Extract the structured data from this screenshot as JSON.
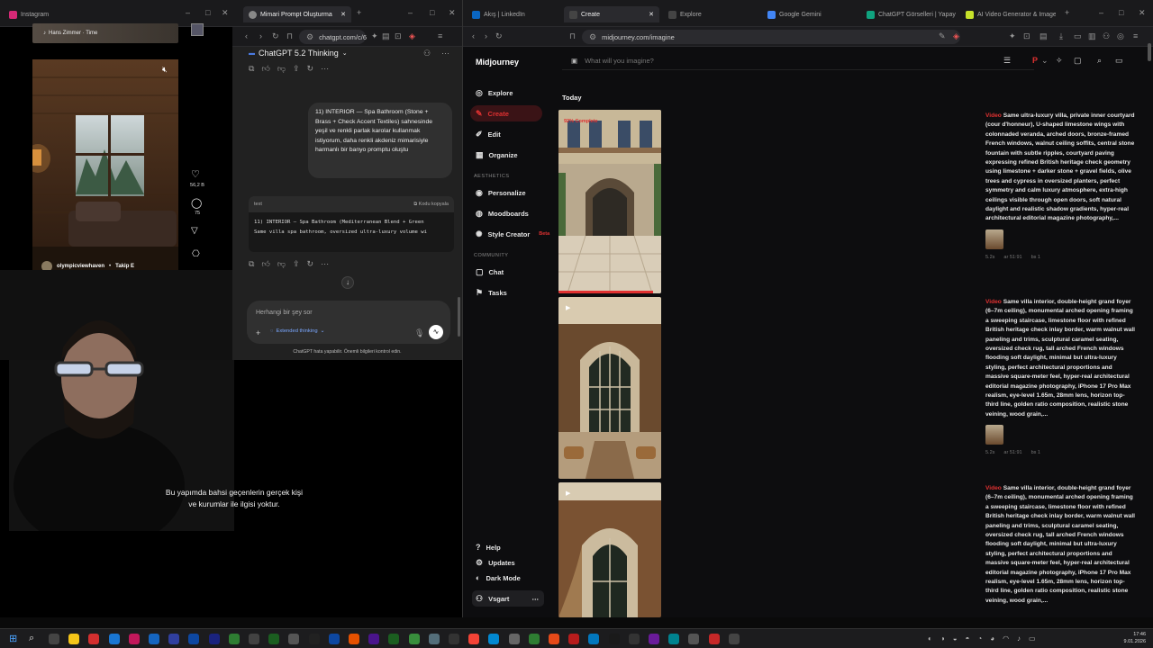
{
  "instagram": {
    "tab_title": "Instagram",
    "music": "Hans Zimmer · Time",
    "like_count": "56,2 B",
    "comment_count": "75",
    "username": "olympicviewhaven",
    "follow_label": "Takip E"
  },
  "subtitle": {
    "line1": "Bu yapımda bahsi geçenlerin gerçek kişi",
    "line2": "ve kurumlar ile ilgisi yoktur."
  },
  "chatgpt": {
    "tab_title": "Mimari Prompt Oluşturma",
    "url": "chatgpt.com/c/6",
    "model": "ChatGPT 5.2 Thinking",
    "user_message": "11) INTERIOR — Spa Bathroom (Stone + Brass + Check Accent Textiles) sahnesinde yeşil ve renkli parlak karolar kullanmak istiyorum, daha renkli akdeniz mimarisiyle harmanlı bir banyo promptu oluştu",
    "code_lang": "text",
    "copy_code_label": "Kodu kopyala",
    "code_line1": "11) INTERIOR — Spa Bathroom (Mediterranean Blend + Green",
    "code_line2": "Same villa spa bathroom, oversized ultra-luxury volume wi",
    "input_placeholder": "Herhangi bir şey sor",
    "extended_thinking": "Extended thinking",
    "footer": "ChatGPT hata yapabilir. Önemli bilgileri kontrol edin."
  },
  "browser2": {
    "tabs": [
      {
        "title": "Akış | LinkedIn",
        "color": "#0a66c2"
      },
      {
        "title": "Create",
        "color": "#444"
      },
      {
        "title": "Explore",
        "color": "#444"
      },
      {
        "title": "Google Gemini",
        "color": "#4285f4"
      },
      {
        "title": "ChatGPT Görselleri | Yapay Zekâ",
        "color": "#10a37f"
      },
      {
        "title": "AI Video Generator & Image Ge",
        "color": "#c6e12a"
      }
    ],
    "url": "midjourney.com/imagine"
  },
  "midjourney": {
    "brand": "Midjourney",
    "search_placeholder": "What will you imagine?",
    "nav": [
      "Explore",
      "Create",
      "Edit",
      "Organize"
    ],
    "aesthetics_heading": "AESTHETICS",
    "aesthetics": [
      "Personalize",
      "Moodboards",
      "Style Creator"
    ],
    "beta_badge": "Beta",
    "community_heading": "COMMUNITY",
    "community": [
      "Chat",
      "Tasks"
    ],
    "bottom": [
      "Help",
      "Updates",
      "Dark Mode"
    ],
    "user": "Vsgart",
    "today_label": "Today",
    "progress_label": "92% Complete",
    "progress_fraction": 0.92,
    "jobs": [
      {
        "tag": "Video",
        "prompt": "Same ultra-luxury villa, private inner courtyard (cour d'honneur), U-shaped limestone wings with colonnaded veranda, arched doors, bronze-framed French windows, walnut ceiling soffits, central stone fountain with subtle ripples, courtyard paving expressing refined British heritage check geometry using limestone + darker stone + gravel fields, olive trees and cypress in oversized planters, perfect symmetry and calm luxury atmosphere, extra-high ceilings visible through open doors, soft natural daylight and realistic shadow gradients, hyper-real architectural editorial magazine photography,...",
        "meta": [
          "5.2s",
          "ar 51:91",
          "bs 1"
        ]
      },
      {
        "tag": "Video",
        "prompt": "Same villa interior, double-height grand foyer (6–7m ceiling), monumental arched opening framing a sweeping staircase, limestone floor with refined British heritage check inlay border, warm walnut wall paneling and trims, sculptural caramel seating, oversized check rug, tall arched French windows flooding soft daylight, minimal but ultra-luxury styling, perfect architectural proportions and massive square-meter feel, hyper-real architectural editorial magazine photography, iPhone 17 Pro Max realism, eye-level 1.65m, 28mm lens, horizon top-third line, golden ratio composition, realistic stone veining, wood grain,...",
        "meta": [
          "5.2s",
          "ar 51:91",
          "bs 1"
        ]
      },
      {
        "tag": "Video",
        "prompt": "Same villa interior, double-height grand foyer (6–7m ceiling), monumental arched opening framing a sweeping staircase, limestone floor with refined British heritage check inlay border, warm walnut wall paneling and trims, sculptural caramel seating, oversized check rug, tall arched French windows flooding soft daylight, minimal but ultra-luxury styling, perfect architectural proportions and massive square-meter feel, hyper-real architectural editorial magazine photography, iPhone 17 Pro Max realism, eye-level 1.65m, 28mm lens, horizon top-third line, golden ratio composition, realistic stone veining, wood grain,...",
        "meta": []
      }
    ]
  },
  "clock": {
    "time": "17:46",
    "date": "9.01.2026"
  },
  "colors": {
    "accent_red": "#e03131",
    "mj_bg": "#0d0d0f",
    "chat_bg": "#212121"
  }
}
